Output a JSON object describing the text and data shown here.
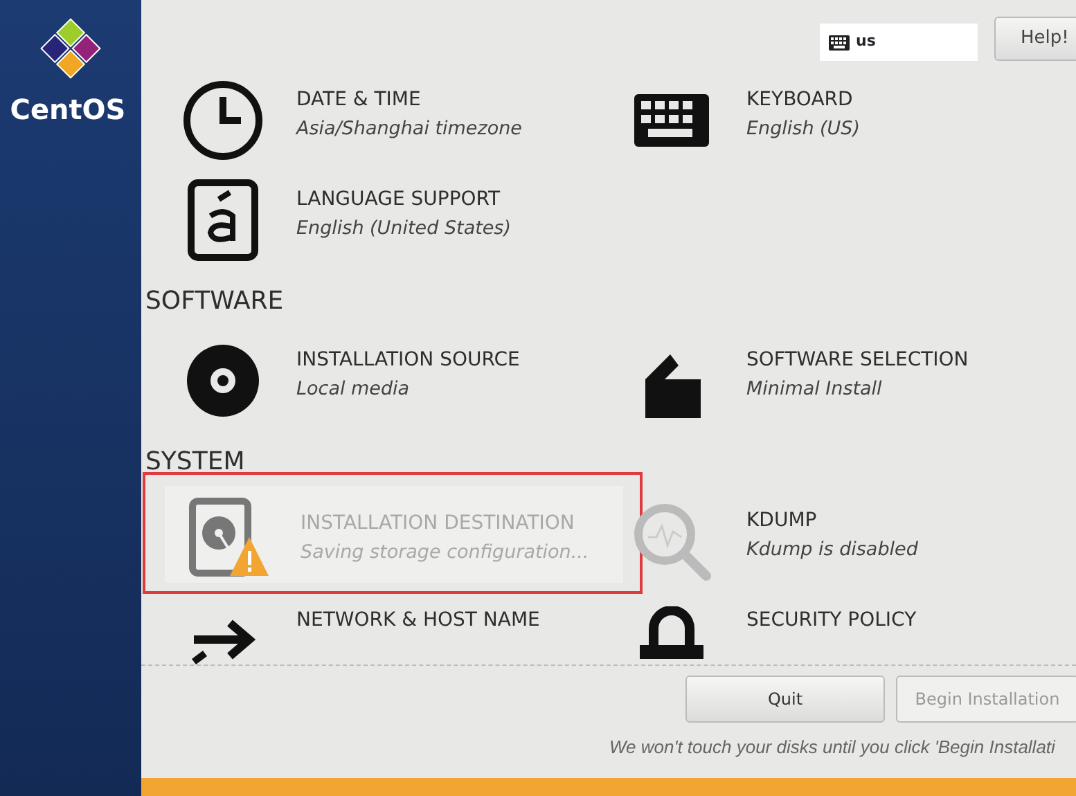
{
  "sidebar": {
    "logo_text": "CentOS"
  },
  "header": {
    "keyboard_layout": "us",
    "help_button": "Help!"
  },
  "sections": [
    {
      "items": [
        {
          "title": "DATE & TIME",
          "status": "Asia/Shanghai timezone",
          "disabled": false,
          "highlighted": false
        },
        {
          "title": "KEYBOARD",
          "status": "English (US)",
          "disabled": false,
          "highlighted": false
        },
        {
          "title": "LANGUAGE SUPPORT",
          "status": "English (United States)",
          "disabled": false,
          "highlighted": false
        }
      ]
    },
    {
      "title": "SOFTWARE",
      "items": [
        {
          "title": "INSTALLATION SOURCE",
          "status": "Local media",
          "disabled": false,
          "highlighted": false
        },
        {
          "title": "SOFTWARE SELECTION",
          "status": "Minimal Install",
          "disabled": false,
          "highlighted": false
        }
      ]
    },
    {
      "title": "SYSTEM",
      "items": [
        {
          "title": "INSTALLATION DESTINATION",
          "status": "Saving storage configuration...",
          "disabled": true,
          "highlighted": true
        },
        {
          "title": "KDUMP",
          "status": "Kdump is disabled",
          "disabled": false,
          "highlighted": false
        },
        {
          "title": "NETWORK & HOST NAME",
          "disabled": false,
          "highlighted": false
        },
        {
          "title": "SECURITY POLICY",
          "disabled": false,
          "highlighted": false
        }
      ]
    }
  ],
  "footer": {
    "buttons": [
      {
        "label": "Quit",
        "disabled": false
      },
      {
        "label": "Begin Installation",
        "disabled": true
      }
    ],
    "note": "We won't touch your disks until you click 'Begin Installati"
  },
  "warning_bar": {
    "shown": true
  }
}
